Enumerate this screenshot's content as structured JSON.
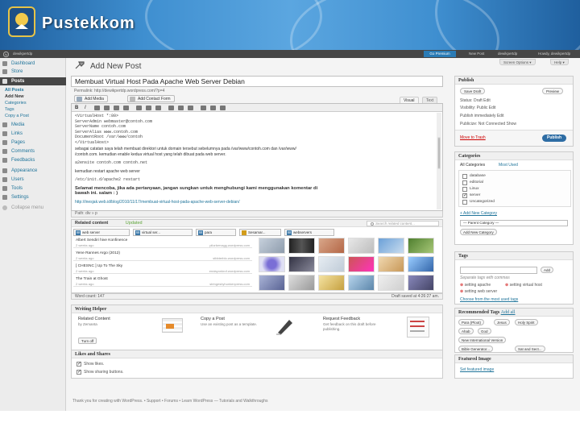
{
  "banner": {
    "logo_text": "Pustekkom"
  },
  "admin_bar": {
    "site": "dewikpertdp",
    "go_premium": "Go Premium",
    "new_post": "New Post",
    "user": "dewikpertdp",
    "user2": "Howdy, dewikpertdp"
  },
  "screen_options": {
    "screen": "Screen Options ▾",
    "help": "Help ▾"
  },
  "sidebar": {
    "items": [
      {
        "label": "Dashboard"
      },
      {
        "label": "Store"
      },
      {
        "label": "Posts"
      },
      {
        "label": "Media"
      },
      {
        "label": "Links"
      },
      {
        "label": "Pages"
      },
      {
        "label": "Comments"
      },
      {
        "label": "Feedbacks"
      },
      {
        "label": "Appearance"
      },
      {
        "label": "Users"
      },
      {
        "label": "Tools"
      },
      {
        "label": "Settings"
      },
      {
        "label": "Collapse menu"
      }
    ],
    "sub_items": [
      "All Posts",
      "Add New",
      "Categories",
      "Tags",
      "Copy a Post"
    ]
  },
  "editor": {
    "page_title": "Add New Post",
    "post_title": "Membuat Virtual Host Pada Apache Web Server Debian",
    "permalink": "Permalink: http://dewikpertdp.wordpress.com/?p=4",
    "add_media": "Add Media",
    "add_contact_form": "Add Contact Form",
    "tab_visual": "Visual",
    "tab_text": "Text",
    "lines": [
      {
        "cls": "mono",
        "text": "<VirtualHost *:80>"
      },
      {
        "cls": "mono",
        "text": "ServerAdmin webmaster@contoh.com"
      },
      {
        "cls": "mono",
        "text": "ServerName contoh.com"
      },
      {
        "cls": "mono",
        "text": "ServerAlias www.contoh.com"
      },
      {
        "cls": "mono",
        "text": "DocumentRoot /var/www/contoh"
      },
      {
        "cls": "mono",
        "text": "</VirtualHost>"
      },
      {
        "cls": "",
        "text": "sebagai catatan saya telah membuat direktori untuk domain tersebut sebelumnya pada /var/www/contoh.com dan /var/www/"
      },
      {
        "cls": "",
        "text": "/contoh.com. kemudian enable kedua virtual host yang telah dibuat pada web server."
      },
      {
        "cls": "mono",
        "text": "a2ensite contoh.com contoh.net"
      },
      {
        "cls": "",
        "text": "kemudian restart apache web server"
      },
      {
        "cls": "mono",
        "text": "/etc/init.d/apache2 restart"
      },
      {
        "cls": "bold",
        "text": "Selamat mencoba, jika ada pertanyaan, jangan sungkan untuk menghubungi kami menggunakan komentar di"
      },
      {
        "cls": "bold",
        "text": "bawah ini. salam : )"
      },
      {
        "cls": "link",
        "text": "http://inesjak.web.id/blog/2010/11/17/membuat-virtual-host-pada-apache-web-server-debian/"
      }
    ],
    "path": "Path: div » p"
  },
  "related": {
    "title": "Related content",
    "badge": "Updated",
    "search_placeholder": "Search related content...",
    "chips": [
      "web server",
      "virtual ser...",
      "para",
      "Sesamar...",
      "webservers"
    ],
    "items": [
      {
        "title": "Albert Sendiri hive Konfinence",
        "date": "2 weeks ago",
        "source": "pilorkervsgg.wordpress.com"
      },
      {
        "title": "Yene Rannes Argo (2012)",
        "date": "2 weeks ago",
        "source": "stbbterblo.wordpress.com"
      },
      {
        "title": "[ CHESNC ] Up To The Sky",
        "date": "2 weeks ago",
        "source": "endayonkrof.wordpress.com"
      },
      {
        "title": "The Train at Ghost",
        "date": "2 weeks ago",
        "source": "stringesbyhunkenpress.com"
      }
    ]
  },
  "status": {
    "word_count": "Word count: 147",
    "draft_saved": "Draft saved at 4:26:27 am."
  },
  "writing_helper": {
    "title": "Writing Helper",
    "related_title": "Related Content",
    "related_by": "by Zemanta",
    "turn_off": "Turn off",
    "copy_title": "Copy a Post",
    "copy_desc": "Use an existing post as a template.",
    "feedback_title": "Request Feedback",
    "feedback_desc": "Get feedback on this draft before publishing."
  },
  "likes": {
    "title": "Likes and Shares",
    "show_likes": "Show likes.",
    "show_sharing": "Show sharing buttons."
  },
  "footer": "Thank you for creating with WordPress. • Support • Forums • Learn WordPress — Tutorials and Walkthroughs",
  "publish": {
    "title": "Publish",
    "save_draft": "Save Draft",
    "preview": "Preview",
    "status": "Status: Draft Edit",
    "visibility": "Visibility: Public Edit",
    "publish_immediately": "Publish immediately Edit",
    "publicize": "Publicize: Not Connected Show",
    "move_to_trash": "Move to Trash",
    "publish_btn": "Publish"
  },
  "categories": {
    "title": "Categories",
    "tab_all": "All Categories",
    "tab_most": "Most Used",
    "items": [
      {
        "label": "database",
        "checked": false
      },
      {
        "label": "editorial",
        "checked": false
      },
      {
        "label": "Linux",
        "checked": false
      },
      {
        "label": "server",
        "checked": true
      },
      {
        "label": "Uncategorized",
        "checked": false
      }
    ],
    "add_new_link": "+ Add New Category",
    "parent_select": "— Parent Category —",
    "add_new_btn": "Add New Category"
  },
  "tags": {
    "title": "Tags",
    "add_btn": "Add",
    "hint": "Separate tags with commas",
    "existing": [
      "setting apache",
      "setting virtual host",
      "setting web server"
    ],
    "choose_link": "Choose from the most used tags"
  },
  "rec_tags": {
    "title": "Recommended Tags",
    "add_all": "Add all",
    "items": [
      "Para (Ploot)",
      "Jesus",
      "Holy Spirit",
      "Ahab",
      "God",
      "New International Version",
      "Bible Generator...",
      "Sat and Sect..."
    ]
  },
  "featured": {
    "title": "Featured Image",
    "link": "Set featured image"
  }
}
